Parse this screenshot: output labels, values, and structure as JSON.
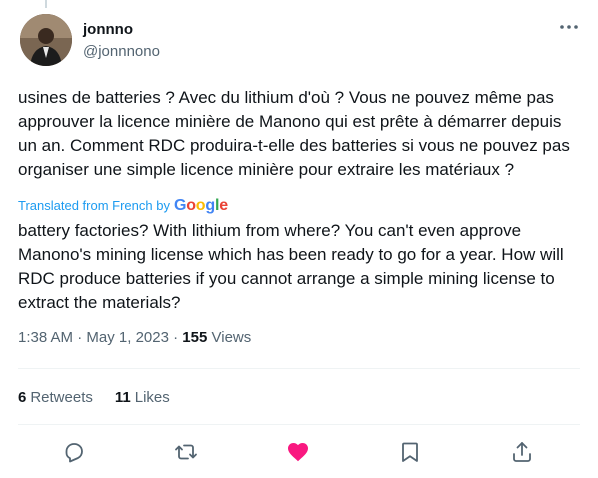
{
  "tweet": {
    "author": {
      "display_name": "jonnno",
      "handle": "@jonnnono",
      "avatar_icon": "user-avatar-photo"
    },
    "more_icon": "more-horizontal-icon",
    "original_text": "usines de batteries ? Avec du lithium d'où ? Vous ne pouvez même pas approuver la licence minière de Manono qui est prête à démarrer depuis un an. Comment RDC produira-t-elle des batteries si vous ne pouvez pas organiser une simple licence minière pour extraire les matériaux ?",
    "translation": {
      "label": "Translated from French by",
      "provider": "Google",
      "text": "battery factories? With lithium from where? You can't even approve Manono's mining license which has been ready to go for a year. How will RDC produce batteries if you cannot arrange a simple mining license to extract the materials?"
    },
    "meta": {
      "time": "1:38 AM",
      "separator": "·",
      "date": "May 1, 2023",
      "views_count": "155",
      "views_label": "Views"
    },
    "stats": {
      "retweets_count": "6",
      "retweets_label": "Retweets",
      "likes_count": "11",
      "likes_label": "Likes"
    },
    "actions": {
      "reply_icon": "reply-icon",
      "retweet_icon": "retweet-icon",
      "like_icon": "heart-icon",
      "bookmark_icon": "bookmark-icon",
      "share_icon": "share-icon"
    },
    "colors": {
      "accent": "#1d9bf0",
      "like_active": "#f91880",
      "secondary_text": "#536471",
      "icon": "#536471"
    }
  }
}
